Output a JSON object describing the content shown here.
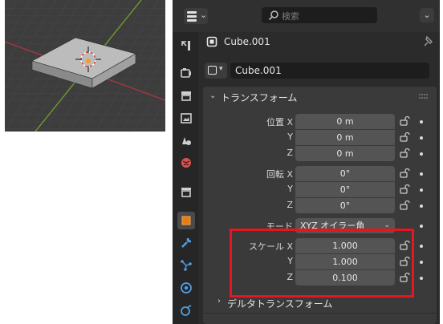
{
  "search": {
    "placeholder": "検索"
  },
  "header": {
    "object_name": "Cube.001"
  },
  "name_field": {
    "value": "Cube.001"
  },
  "transform": {
    "title": "トランスフォーム",
    "location": {
      "label_x": "位置 X",
      "label_y": "Y",
      "label_z": "Z",
      "x": "0 m",
      "y": "0 m",
      "z": "0 m"
    },
    "rotation": {
      "label_x": "回転 X",
      "label_y": "Y",
      "label_z": "Z",
      "x": "0°",
      "y": "0°",
      "z": "0°"
    },
    "mode": {
      "label": "モード",
      "value": "XYZ オイラー角"
    },
    "scale": {
      "label_x": "スケール X",
      "label_y": "Y",
      "label_z": "Z",
      "x": "1.000",
      "y": "1.000",
      "z": "0.100"
    },
    "delta_title": "デルタトランスフォーム"
  },
  "colors": {
    "highlight": "#e8141e",
    "accent_active_tab": "#e87d0d"
  }
}
